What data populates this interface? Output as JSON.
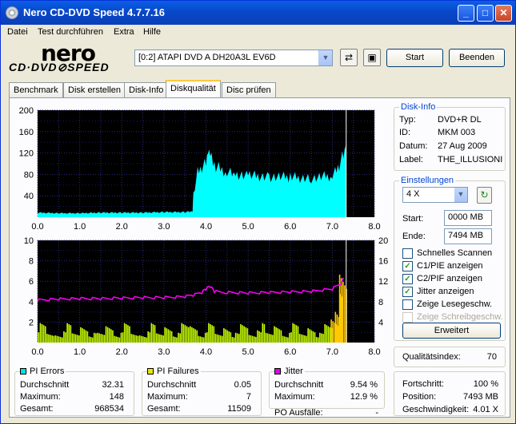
{
  "window": {
    "title": "Nero CD-DVD Speed 4.7.7.16",
    "min": "_",
    "max": "□",
    "close": "✕"
  },
  "menu": [
    "Datei",
    "Test durchführen",
    "Extra",
    "Hilfe"
  ],
  "logo": {
    "line1": "nero",
    "line2": "CD·DVD⊘SPEED"
  },
  "toolbar": {
    "drive": "[0:2]   ATAPI DVD A  DH20A3L EV6D",
    "start": "Start",
    "end": "Beenden"
  },
  "tabs": [
    "Benchmark",
    "Disk erstellen",
    "Disk-Info",
    "Diskqualität",
    "Disc prüfen"
  ],
  "disk_info": {
    "caption": "Disk-Info",
    "rows": [
      {
        "label": "Typ:",
        "value": "DVD+R DL"
      },
      {
        "label": "ID:",
        "value": "MKM 003"
      },
      {
        "label": "Datum:",
        "value": "27 Aug 2009"
      },
      {
        "label": "Label:",
        "value": "THE_ILLUSIONI"
      }
    ]
  },
  "settings": {
    "caption": "Einstellungen",
    "speed": "4 X",
    "start_label": "Start:",
    "start_value": "0000 MB",
    "end_label": "Ende:",
    "end_value": "7494 MB",
    "checks": [
      {
        "label": "Schnelles Scannen",
        "checked": false,
        "disabled": false
      },
      {
        "label": "C1/PIE anzeigen",
        "checked": true,
        "disabled": false
      },
      {
        "label": "C2/PIF anzeigen",
        "checked": true,
        "disabled": false
      },
      {
        "label": "Jitter anzeigen",
        "checked": true,
        "disabled": false
      },
      {
        "label": "Zeige Lesegeschw.",
        "checked": false,
        "disabled": false
      },
      {
        "label": "Zeige Schreibgeschw.",
        "checked": false,
        "disabled": true
      }
    ],
    "advanced": "Erweitert"
  },
  "quality": {
    "label": "Qualitätsindex:",
    "value": "70"
  },
  "progress": {
    "rows": [
      {
        "label": "Fortschritt:",
        "value": "100 %"
      },
      {
        "label": "Position:",
        "value": "7493 MB"
      },
      {
        "label": "Geschwindigkeit:",
        "value": "4.01 X"
      }
    ]
  },
  "stats": {
    "pi_errors": {
      "caption": "PI Errors",
      "color": "#00e0e0",
      "rows": [
        {
          "label": "Durchschnitt",
          "value": "32.31"
        },
        {
          "label": "Maximum:",
          "value": "148"
        },
        {
          "label": "Gesamt:",
          "value": "968534"
        }
      ]
    },
    "pi_failures": {
      "caption": "PI Failures",
      "color": "#e8e800",
      "rows": [
        {
          "label": "Durchschnitt",
          "value": "0.05"
        },
        {
          "label": "Maximum:",
          "value": "7"
        },
        {
          "label": "Gesamt:",
          "value": "11509"
        }
      ]
    },
    "jitter": {
      "caption": "Jitter",
      "color": "#e000e0",
      "rows": [
        {
          "label": "Durchschnitt",
          "value": "9.54 %"
        },
        {
          "label": "Maximum:",
          "value": "12.9 %"
        }
      ],
      "po_label": "PO Ausfälle:",
      "po_value": "-"
    }
  },
  "chart_data": [
    {
      "type": "area",
      "series": [
        {
          "name": "PI Errors",
          "color": "#00ffff",
          "x": [
            0,
            0.5,
            1,
            1.5,
            2,
            2.5,
            3,
            3.5,
            3.68,
            3.7,
            3.8,
            3.9,
            4.0,
            4.05,
            4.1,
            4.2,
            4.3,
            4.5,
            4.7,
            5.0,
            5.5,
            6.0,
            6.5,
            7.0,
            7.1,
            7.2,
            7.3,
            7.32,
            7.33
          ],
          "values": [
            8,
            7,
            7,
            8,
            8,
            8,
            9,
            9,
            10,
            42,
            82,
            92,
            100,
            118,
            107,
            92,
            88,
            82,
            78,
            75,
            73,
            72,
            70,
            75,
            82,
            98,
            118,
            155,
            0
          ]
        }
      ],
      "xlim": [
        0,
        8
      ],
      "ylim": [
        0,
        200
      ],
      "xticks": [
        "0.0",
        "1.0",
        "2.0",
        "3.0",
        "4.0",
        "5.0",
        "6.0",
        "7.0",
        "8.0"
      ],
      "yticks": [
        "40",
        "80",
        "120",
        "160",
        "200"
      ],
      "grid": true
    },
    {
      "type": "bar",
      "series": [
        {
          "name": "PI Failures",
          "color": "#c8ff00",
          "x": [
            0.1,
            0.3,
            0.5,
            0.7,
            0.9,
            1.1,
            1.3,
            1.5,
            1.7,
            1.9,
            2.1,
            2.3,
            2.5,
            2.7,
            2.9,
            3.1,
            3.3,
            3.5,
            3.7,
            3.9,
            4.1,
            4.3,
            4.5,
            4.7,
            4.9,
            5.1,
            5.3,
            5.5,
            5.7,
            5.9,
            6.1,
            6.3,
            6.5,
            6.7,
            6.9,
            7.05,
            7.15,
            7.25
          ],
          "values": [
            2,
            1,
            1,
            2,
            1,
            2,
            1,
            1,
            2,
            1,
            2,
            1,
            1,
            2,
            1,
            2,
            1,
            2,
            2,
            1,
            2,
            1,
            2,
            1,
            2,
            1,
            2,
            1,
            2,
            1,
            2,
            1,
            2,
            1,
            2,
            3,
            5,
            7
          ]
        },
        {
          "name": "Jitter",
          "color": "#ff00ff",
          "x": [
            0,
            0.5,
            1,
            1.5,
            2,
            2.5,
            3,
            3.5,
            3.7,
            3.9,
            4.0,
            4.1,
            4.2,
            4.5,
            5.0,
            5.5,
            6.0,
            6.5,
            7.0,
            7.2,
            7.3
          ],
          "values": [
            8.3,
            8.5,
            8.6,
            8.6,
            8.7,
            8.8,
            8.8,
            9.0,
            9.3,
            9.8,
            10.5,
            11.0,
            10.0,
            9.8,
            9.7,
            9.8,
            9.9,
            10.0,
            10.5,
            11.5,
            13.0
          ]
        }
      ],
      "xlim": [
        0,
        8
      ],
      "ylim_left": [
        0,
        10
      ],
      "ylim_right": [
        0,
        20
      ],
      "xticks": [
        "0.0",
        "1.0",
        "2.0",
        "3.0",
        "4.0",
        "5.0",
        "6.0",
        "7.0",
        "8.0"
      ],
      "yticks_left": [
        "2",
        "4",
        "6",
        "8",
        "10"
      ],
      "yticks_right": [
        "4",
        "8",
        "12",
        "16",
        "20"
      ],
      "grid": true
    }
  ]
}
